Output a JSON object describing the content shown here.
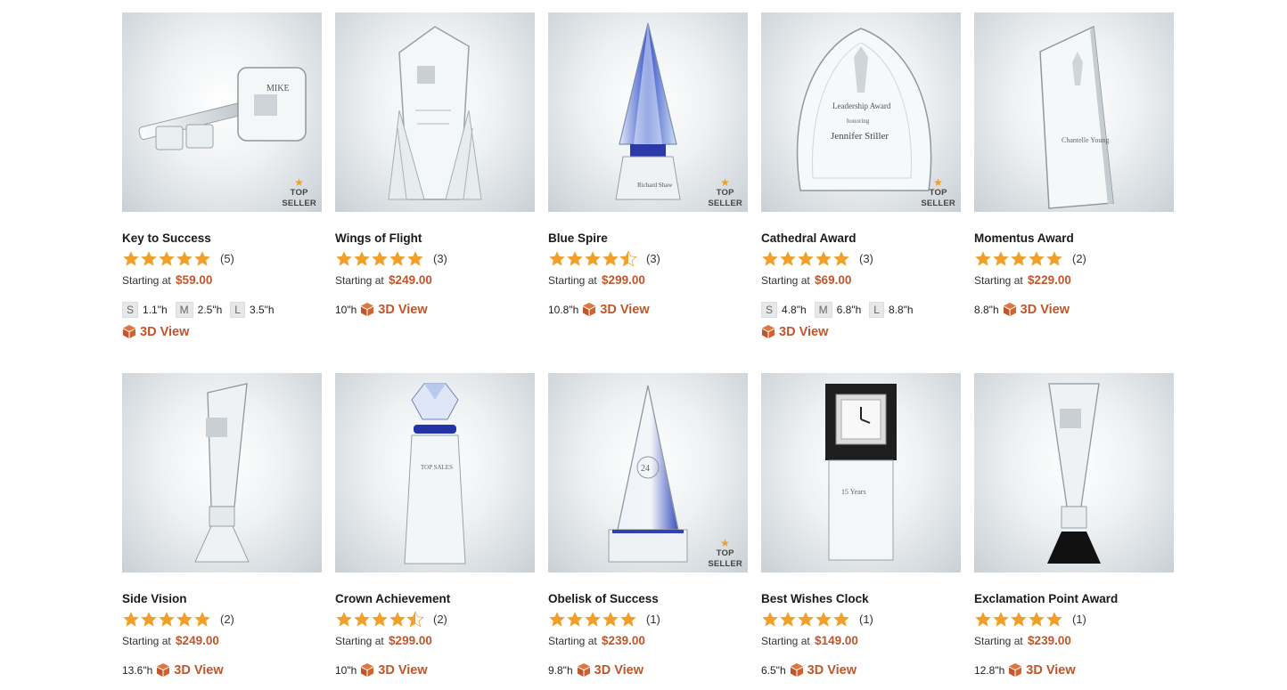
{
  "colors": {
    "accent": "#c0562b",
    "star": "#f0a02a",
    "badge": "#444444"
  },
  "badge": {
    "star": "★",
    "line1": "TOP",
    "line2": "SELLER"
  },
  "price_prefix": "Starting at",
  "view3d_label": "3D View",
  "products": [
    {
      "name": "Key to Success",
      "rating": 5,
      "reviews": "(5)",
      "price": "$59.00",
      "top_seller": true,
      "sizes": [
        {
          "code": "S",
          "dim": "1.1\"h"
        },
        {
          "code": "M",
          "dim": "2.5\"h"
        },
        {
          "code": "L",
          "dim": "3.5\"h"
        }
      ],
      "height": null,
      "icon": "key-trophy"
    },
    {
      "name": "Wings of Flight",
      "rating": 5,
      "reviews": "(3)",
      "price": "$249.00",
      "top_seller": false,
      "sizes": [],
      "height": "10\"h",
      "icon": "wings-trophy"
    },
    {
      "name": "Blue Spire",
      "rating": 4.5,
      "reviews": "(3)",
      "price": "$299.00",
      "top_seller": true,
      "sizes": [],
      "height": "10.8\"h",
      "icon": "spire-trophy"
    },
    {
      "name": "Cathedral Award",
      "rating": 5,
      "reviews": "(3)",
      "price": "$69.00",
      "top_seller": true,
      "sizes": [
        {
          "code": "S",
          "dim": "4.8\"h"
        },
        {
          "code": "M",
          "dim": "6.8\"h"
        },
        {
          "code": "L",
          "dim": "8.8\"h"
        }
      ],
      "height": null,
      "icon": "cathedral-trophy"
    },
    {
      "name": "Momentus Award",
      "rating": 5,
      "reviews": "(2)",
      "price": "$229.00",
      "top_seller": false,
      "sizes": [],
      "height": "8.8\"h",
      "icon": "momentus-trophy"
    },
    {
      "name": "Side Vision",
      "rating": 5,
      "reviews": "(2)",
      "price": "$249.00",
      "top_seller": false,
      "sizes": [],
      "height": "13.6\"h",
      "icon": "sidevision-trophy"
    },
    {
      "name": "Crown Achievement",
      "rating": 4.5,
      "reviews": "(2)",
      "price": "$299.00",
      "top_seller": false,
      "sizes": [],
      "height": "10\"h",
      "icon": "crown-trophy"
    },
    {
      "name": "Obelisk of Success",
      "rating": 5,
      "reviews": "(1)",
      "price": "$239.00",
      "top_seller": true,
      "sizes": [],
      "height": "9.8\"h",
      "icon": "obelisk-trophy"
    },
    {
      "name": "Best Wishes Clock",
      "rating": 5,
      "reviews": "(1)",
      "price": "$149.00",
      "top_seller": false,
      "sizes": [],
      "height": "6.5\"h",
      "icon": "clock-trophy"
    },
    {
      "name": "Exclamation Point Award",
      "rating": 5,
      "reviews": "(1)",
      "price": "$239.00",
      "top_seller": false,
      "sizes": [],
      "height": "12.8\"h",
      "icon": "exclamation-trophy"
    }
  ]
}
